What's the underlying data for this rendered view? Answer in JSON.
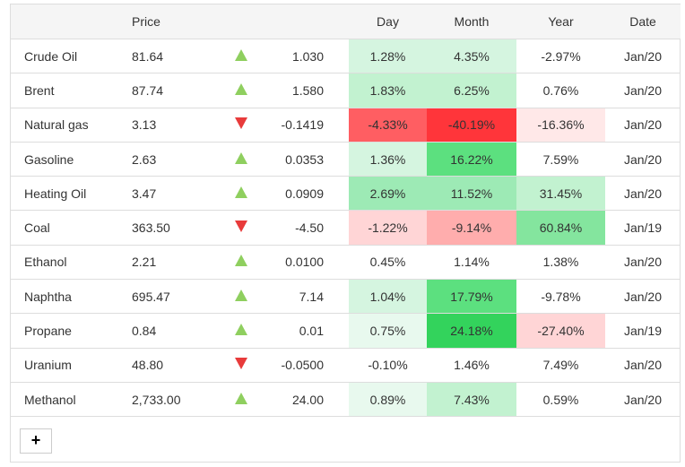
{
  "header": {
    "name": "",
    "price": "Price",
    "arrow": "",
    "change": "",
    "day": "Day",
    "month": "Month",
    "year": "Year",
    "date": "Date"
  },
  "rows": [
    {
      "name": "Crude Oil",
      "price": "81.64",
      "dir": "up",
      "change": "1.030",
      "day": "1.28%",
      "month": "4.35%",
      "year": "-2.97%",
      "date": "Jan/20",
      "day_color": "#d5f5e0",
      "month_color": "#d5f5e0",
      "year_color": ""
    },
    {
      "name": "Brent",
      "price": "87.74",
      "dir": "up",
      "change": "1.580",
      "day": "1.83%",
      "month": "6.25%",
      "year": "0.76%",
      "date": "Jan/20",
      "day_color": "#c2f2d0",
      "month_color": "#c2f2d0",
      "year_color": ""
    },
    {
      "name": "Natural gas",
      "price": "3.13",
      "dir": "down",
      "change": "-0.1419",
      "day": "-4.33%",
      "month": "-40.19%",
      "year": "-16.36%",
      "date": "Jan/20",
      "day_color": "#ff5e62",
      "month_color": "#ff353a",
      "year_color": "#ffe8e8"
    },
    {
      "name": "Gasoline",
      "price": "2.63",
      "dir": "up",
      "change": "0.0353",
      "day": "1.36%",
      "month": "16.22%",
      "year": "7.59%",
      "date": "Jan/20",
      "day_color": "#d5f5e0",
      "month_color": "#5ce07f",
      "year_color": ""
    },
    {
      "name": "Heating Oil",
      "price": "3.47",
      "dir": "up",
      "change": "0.0909",
      "day": "2.69%",
      "month": "11.52%",
      "year": "31.45%",
      "date": "Jan/20",
      "day_color": "#9deab5",
      "month_color": "#9deab5",
      "year_color": "#c2f2d0"
    },
    {
      "name": "Coal",
      "price": "363.50",
      "dir": "down",
      "change": "-4.50",
      "day": "-1.22%",
      "month": "-9.14%",
      "year": "60.84%",
      "date": "Jan/19",
      "day_color": "#ffd5d6",
      "month_color": "#ffadad",
      "year_color": "#84e59e"
    },
    {
      "name": "Ethanol",
      "price": "2.21",
      "dir": "up",
      "change": "0.0100",
      "day": "0.45%",
      "month": "1.14%",
      "year": "1.38%",
      "date": "Jan/20",
      "day_color": "",
      "month_color": "",
      "year_color": ""
    },
    {
      "name": "Naphtha",
      "price": "695.47",
      "dir": "up",
      "change": "7.14",
      "day": "1.04%",
      "month": "17.79%",
      "year": "-9.78%",
      "date": "Jan/20",
      "day_color": "#d5f5e0",
      "month_color": "#5ce07f",
      "year_color": ""
    },
    {
      "name": "Propane",
      "price": "0.84",
      "dir": "up",
      "change": "0.01",
      "day": "0.75%",
      "month": "24.18%",
      "year": "-27.40%",
      "date": "Jan/19",
      "day_color": "#e8f9ee",
      "month_color": "#33d35c",
      "year_color": "#ffd5d6"
    },
    {
      "name": "Uranium",
      "price": "48.80",
      "dir": "down",
      "change": "-0.0500",
      "day": "-0.10%",
      "month": "1.46%",
      "year": "7.49%",
      "date": "Jan/20",
      "day_color": "",
      "month_color": "",
      "year_color": ""
    },
    {
      "name": "Methanol",
      "price": "2,733.00",
      "dir": "up",
      "change": "24.00",
      "day": "0.89%",
      "month": "7.43%",
      "year": "0.59%",
      "date": "Jan/20",
      "day_color": "#e8f9ee",
      "month_color": "#c2f2d0",
      "year_color": ""
    }
  ],
  "add_button": {
    "label": "+",
    "icon": "plus-icon"
  }
}
